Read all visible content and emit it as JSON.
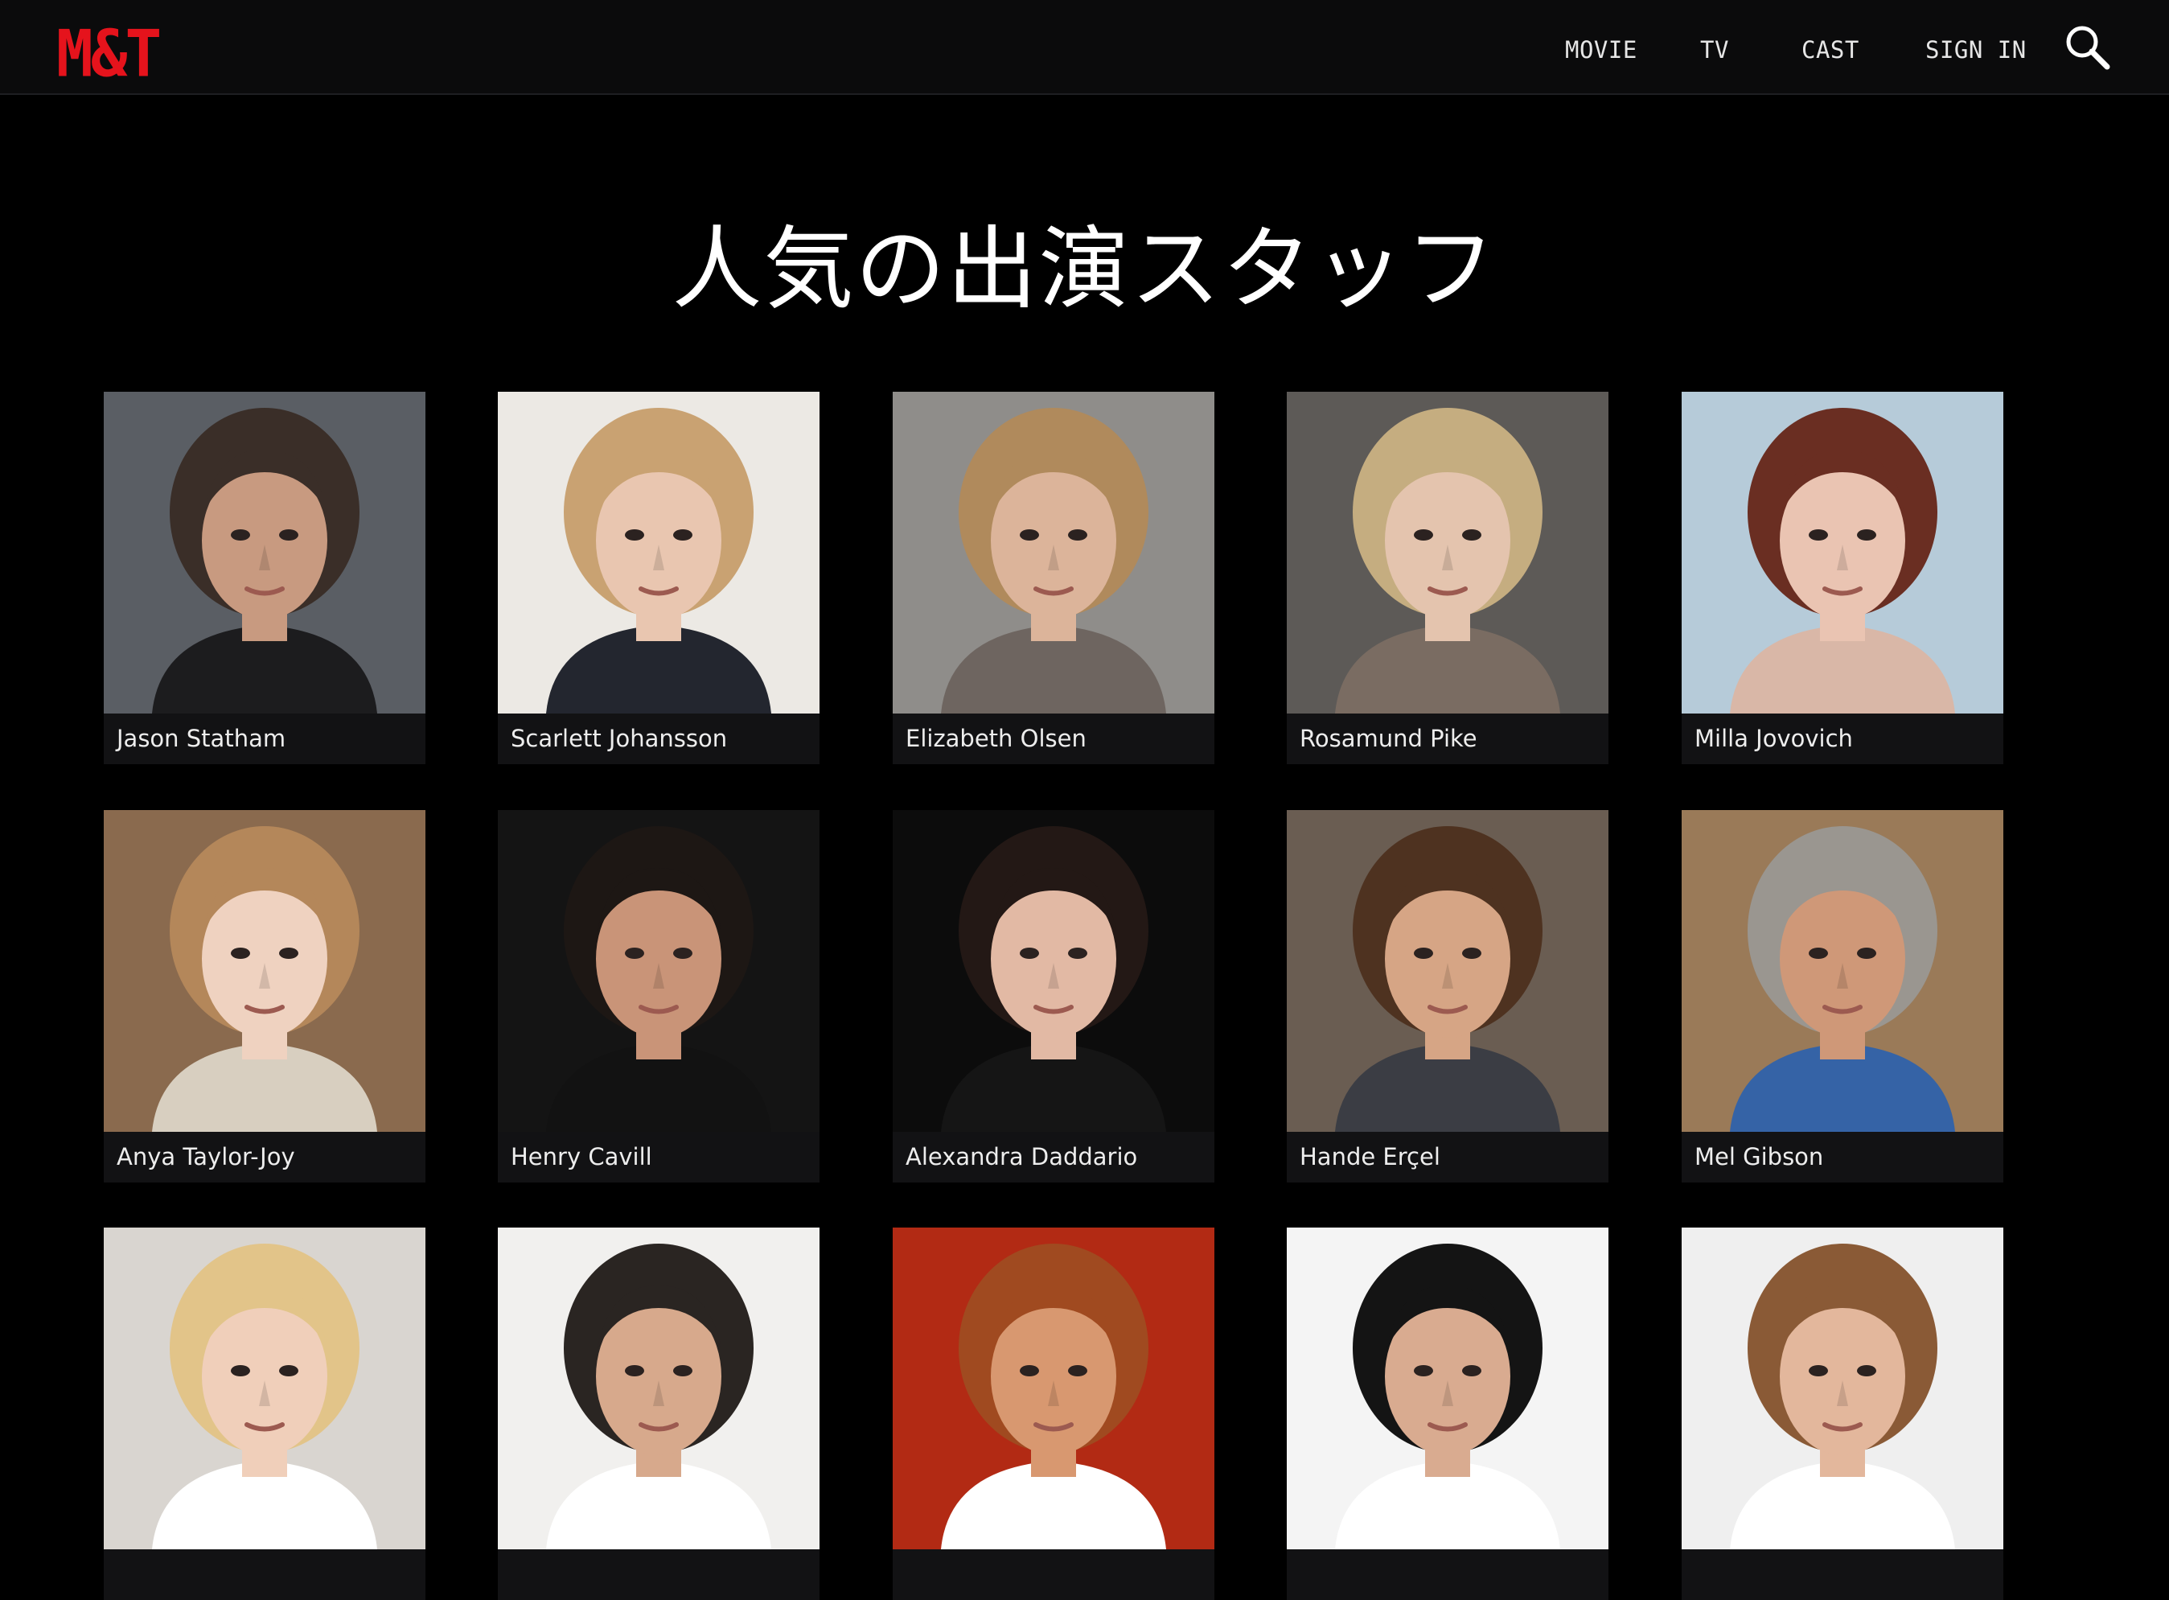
{
  "header": {
    "logo": "M&T",
    "nav_items": [
      "MOVIE",
      "TV",
      "CAST",
      "SIGN IN"
    ],
    "search_icon": "search-icon"
  },
  "main": {
    "title": "人気の出演スタッフ",
    "cast": [
      {
        "name": "Jason Statham",
        "bg": "#5a5e64",
        "skin": "#c89a80",
        "hair": "#3a2e28",
        "shirt": "#1c1c1e"
      },
      {
        "name": "Scarlett Johansson",
        "bg": "#ece9e4",
        "skin": "#e9c6b0",
        "hair": "#c9a272",
        "shirt": "#23262f"
      },
      {
        "name": "Elizabeth Olsen",
        "bg": "#8f8d8a",
        "skin": "#dcb49a",
        "hair": "#b08a5c",
        "shirt": "#6e6560"
      },
      {
        "name": "Rosamund Pike",
        "bg": "#5d5a57",
        "skin": "#e4c4ae",
        "hair": "#c5ad80",
        "shirt": "#7a6c62"
      },
      {
        "name": "Milla Jovovich",
        "bg": "#b6cbd9",
        "skin": "#eac4b2",
        "hair": "#6a2e22",
        "shirt": "#d9b7a7"
      },
      {
        "name": "Anya Taylor-Joy",
        "bg": "#8a6a4e",
        "skin": "#efd2c0",
        "hair": "#b4875a",
        "shirt": "#d8cfc0"
      },
      {
        "name": "Henry Cavill",
        "bg": "#141414",
        "skin": "#c99478",
        "hair": "#1d1714",
        "shirt": "#121212"
      },
      {
        "name": "Alexandra Daddario",
        "bg": "#0c0c0c",
        "skin": "#e2b9a4",
        "hair": "#231815",
        "shirt": "#151515"
      },
      {
        "name": "Hande Erçel",
        "bg": "#6a5d52",
        "skin": "#d6a585",
        "hair": "#4e3220",
        "shirt": "#3b3d44"
      },
      {
        "name": "Mel Gibson",
        "bg": "#9a7a58",
        "skin": "#cf9878",
        "hair": "#9a9690",
        "shirt": "#3563a6"
      },
      {
        "name": "",
        "bg": "#d9d5d0",
        "skin": "#f0cfba",
        "hair": "#e2c489",
        "shirt": "#ffffff"
      },
      {
        "name": "",
        "bg": "#f1f0ee",
        "skin": "#d7a98c",
        "hair": "#2a2522",
        "shirt": "#ffffff"
      },
      {
        "name": "",
        "bg": "#b22a14",
        "skin": "#d89870",
        "hair": "#a04a20",
        "shirt": "#ffffff"
      },
      {
        "name": "",
        "bg": "#f4f4f4",
        "skin": "#d9ab90",
        "hair": "#141414",
        "shirt": "#ffffff"
      },
      {
        "name": "",
        "bg": "#efefef",
        "skin": "#e3b79c",
        "hair": "#8a5a36",
        "shirt": "#ffffff"
      }
    ]
  }
}
